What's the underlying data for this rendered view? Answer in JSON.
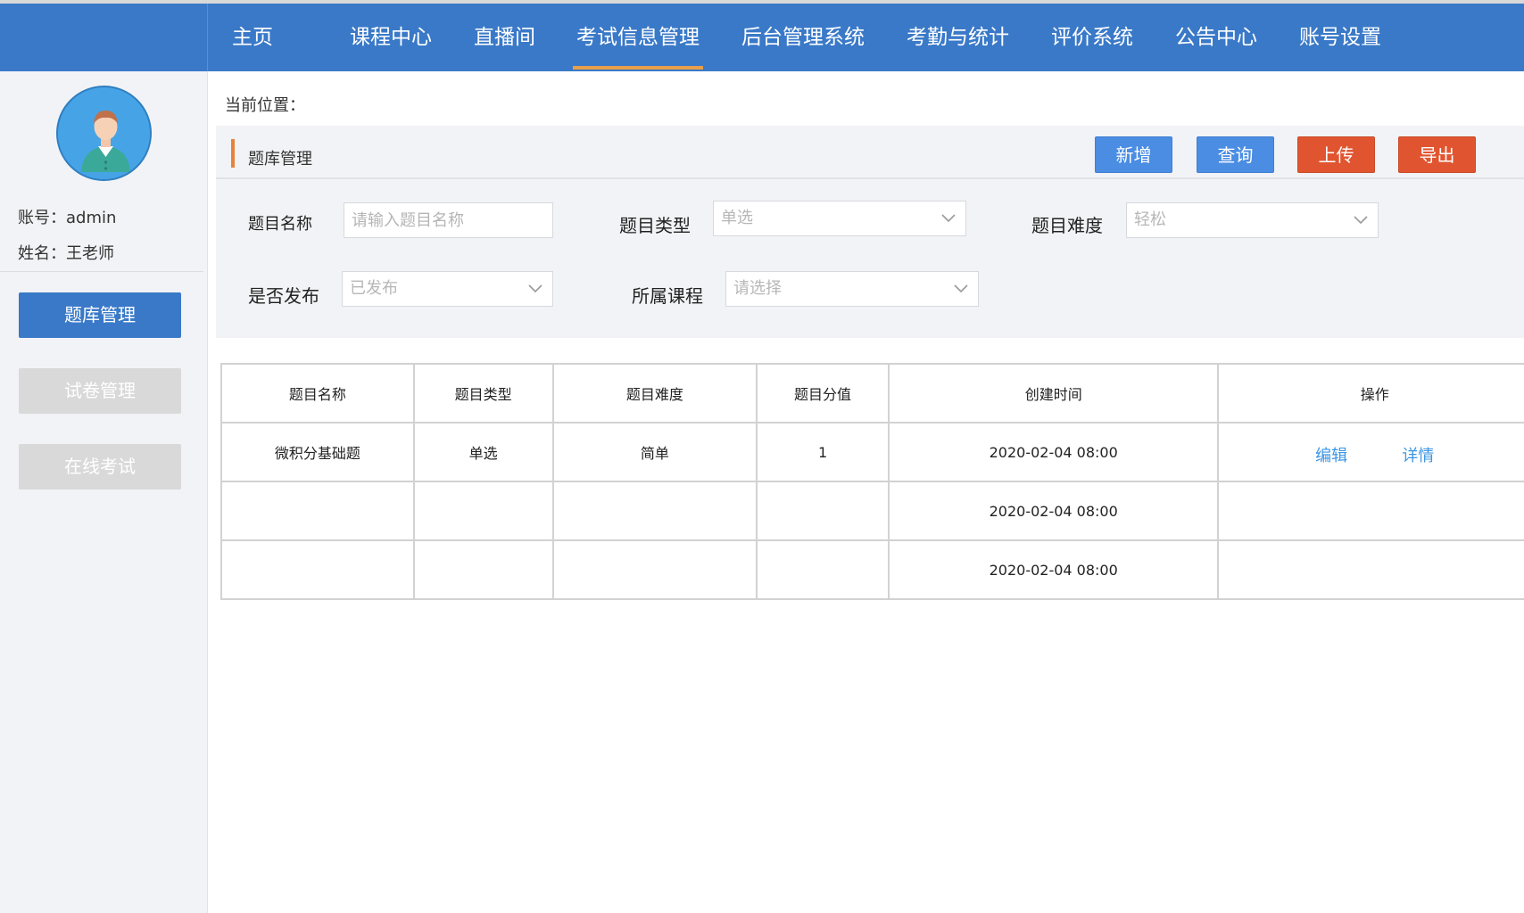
{
  "nav": {
    "items": [
      {
        "label": "主页",
        "active": false
      },
      {
        "label": "课程中心",
        "active": false
      },
      {
        "label": "直播间",
        "active": false
      },
      {
        "label": "考试信息管理",
        "active": true
      },
      {
        "label": "后台管理系统",
        "active": false
      },
      {
        "label": "考勤与统计",
        "active": false
      },
      {
        "label": "评价系统",
        "active": false
      },
      {
        "label": "公告中心",
        "active": false
      },
      {
        "label": "账号设置",
        "active": false
      }
    ]
  },
  "sidebar": {
    "account": "账号：admin",
    "name": "姓名：王老师",
    "menu": [
      "题库管理",
      "试卷管理",
      "在线考试"
    ]
  },
  "breadcrumb": "当前位置：",
  "panel": {
    "title": "题库管理",
    "buttons": {
      "add": "新增",
      "query": "查询",
      "upload": "上传",
      "export": "导出"
    }
  },
  "filters": {
    "name_label": "题目名称",
    "name_placeholder": "请输入题目名称",
    "type_label": "题目类型",
    "type_value": "单选",
    "difficulty_label": "题目难度",
    "difficulty_value": "轻松",
    "published_label": "是否发布",
    "published_value": "已发布",
    "course_label": "所属课程",
    "course_value": "请选择"
  },
  "table": {
    "headers": [
      "题目名称",
      "题目类型",
      "题目难度",
      "题目分值",
      "创建时间",
      "操作"
    ],
    "rows": [
      {
        "name": "微积分基础题",
        "type": "单选",
        "difficulty": "简单",
        "score": "1",
        "created": "2020-02-04 08:00",
        "ops": [
          "编辑",
          "详情"
        ]
      },
      {
        "name": "",
        "type": "",
        "difficulty": "",
        "score": "",
        "created": "2020-02-04 08:00",
        "ops": []
      },
      {
        "name": "",
        "type": "",
        "difficulty": "",
        "score": "",
        "created": "2020-02-04 08:00",
        "ops": []
      }
    ]
  },
  "colors": {
    "primary": "#3a79c8",
    "button_blue": "#4a8de3",
    "button_red": "#e05530",
    "accent_orange": "#e8823a",
    "link": "#3b95e6"
  }
}
